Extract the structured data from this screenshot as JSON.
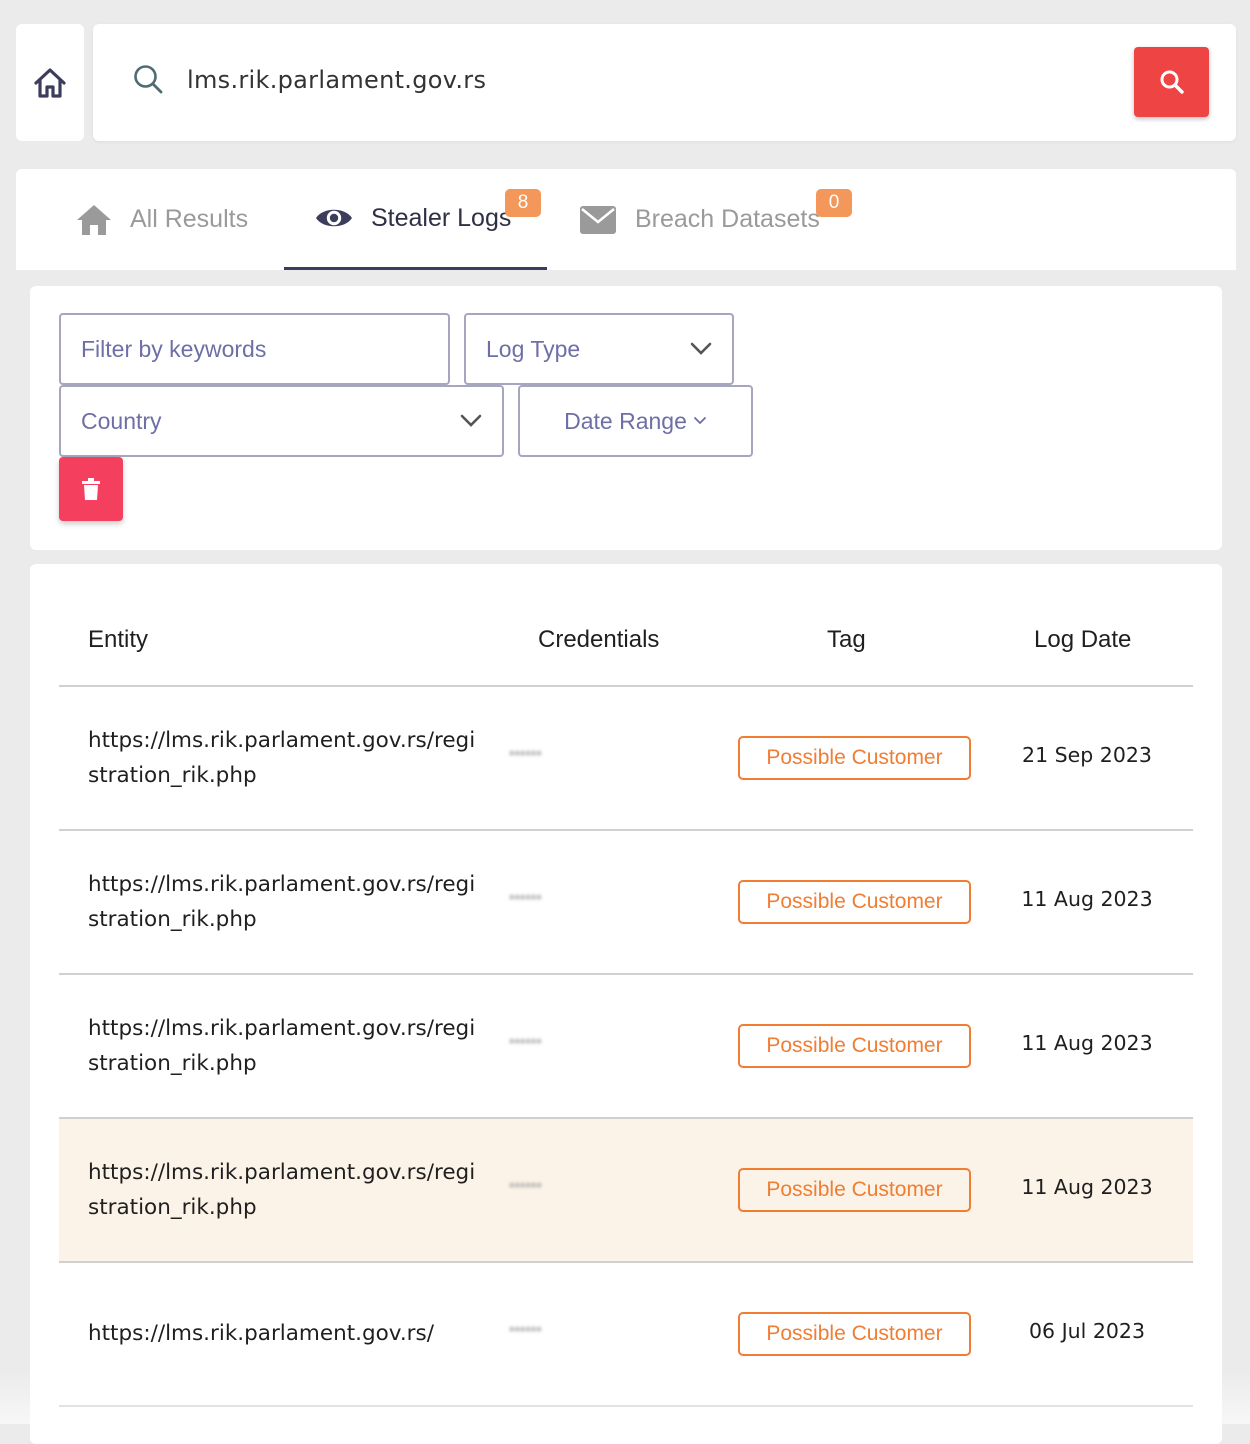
{
  "search": {
    "value": "lms.rik.parlament.gov.rs"
  },
  "tabs": [
    {
      "label": "All Results",
      "icon": "home-icon",
      "badge": null,
      "active": false
    },
    {
      "label": "Stealer Logs",
      "icon": "eye-icon",
      "badge": "8",
      "active": true
    },
    {
      "label": "Breach Datasets",
      "icon": "mail-icon",
      "badge": "0",
      "active": false
    }
  ],
  "filters": {
    "keywords_placeholder": "Filter by keywords",
    "log_type": "Log Type",
    "country": "Country",
    "date_range": "Date Range"
  },
  "table": {
    "headers": {
      "entity": "Entity",
      "credentials": "Credentials",
      "tag": "Tag",
      "log_date": "Log Date"
    },
    "rows": [
      {
        "entity": "https://lms.rik.parlament.gov.rs/registration_rik.php",
        "credentials": "******",
        "tag": "Possible Customer",
        "date": "21 Sep 2023"
      },
      {
        "entity": "https://lms.rik.parlament.gov.rs/registration_rik.php",
        "credentials": "******",
        "tag": "Possible Customer",
        "date": "11 Aug 2023"
      },
      {
        "entity": "https://lms.rik.parlament.gov.rs/registration_rik.php",
        "credentials": "******",
        "tag": "Possible Customer",
        "date": "11 Aug 2023"
      },
      {
        "entity": "https://lms.rik.parlament.gov.rs/registration_rik.php",
        "credentials": "******",
        "tag": "Possible Customer",
        "date": "11 Aug 2023"
      },
      {
        "entity": "https://lms.rik.parlament.gov.rs/",
        "credentials": "******",
        "tag": "Possible Customer",
        "date": "06 Jul 2023"
      }
    ]
  },
  "colors": {
    "accent_red": "#ef4444",
    "trash_red": "#f43f5e",
    "tag_orange": "#f07d32",
    "badge_orange": "#f4975a",
    "highlight_row": "#fcf3e8"
  }
}
